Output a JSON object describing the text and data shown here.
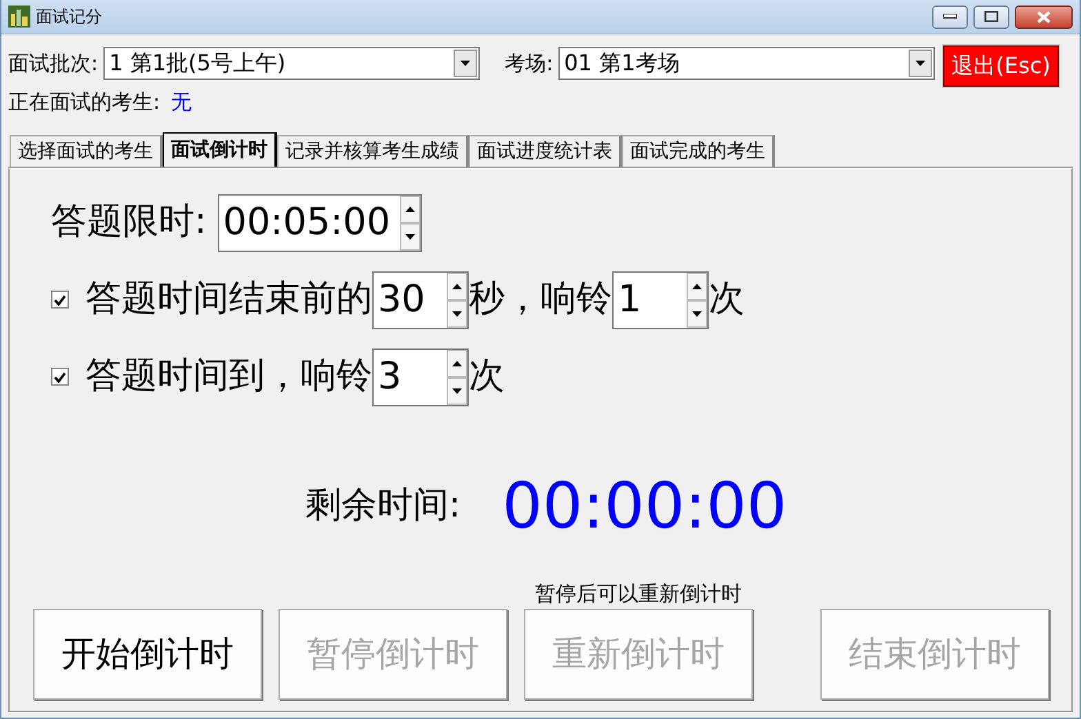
{
  "window": {
    "title": "面试记分"
  },
  "header": {
    "batch_label": "面试批次:",
    "batch_value": "1  第1批(5号上午)",
    "room_label": "考场:",
    "room_value": "01 第1考场",
    "exit_button": "退出(Esc)",
    "current_label": "正在面试的考生:",
    "current_value": "无"
  },
  "tabs": [
    {
      "label": "选择面试的考生",
      "selected": false
    },
    {
      "label": "面试倒计时",
      "selected": true
    },
    {
      "label": "记录并核算考生成绩",
      "selected": false
    },
    {
      "label": "面试进度统计表",
      "selected": false
    },
    {
      "label": "面试完成的考生",
      "selected": false
    }
  ],
  "countdown": {
    "limit_label": "答题限时:",
    "limit_value": "00:05:00",
    "options": [
      {
        "checked": true,
        "segments": [
          {
            "kind": "text",
            "text": "答题时间结束前的"
          },
          {
            "kind": "spin",
            "value": "30"
          },
          {
            "kind": "text",
            "text": "秒，响铃"
          },
          {
            "kind": "spin",
            "value": "1"
          },
          {
            "kind": "text",
            "text": "次"
          }
        ]
      },
      {
        "checked": true,
        "segments": [
          {
            "kind": "text",
            "text": "答题时间到，响铃"
          },
          {
            "kind": "spin",
            "value": "3"
          },
          {
            "kind": "text",
            "text": "次"
          }
        ]
      }
    ],
    "remaining_label": "剩余时间:",
    "remaining_value": "00:00:00"
  },
  "buttons": [
    {
      "label": "开始倒计时",
      "disabled": false
    },
    {
      "label": "暂停倒计时",
      "disabled": true
    },
    {
      "label": "重新倒计时",
      "disabled": true,
      "note": "暂停后可以重新倒计时"
    },
    {
      "label": "结束倒计时",
      "disabled": true
    }
  ]
}
